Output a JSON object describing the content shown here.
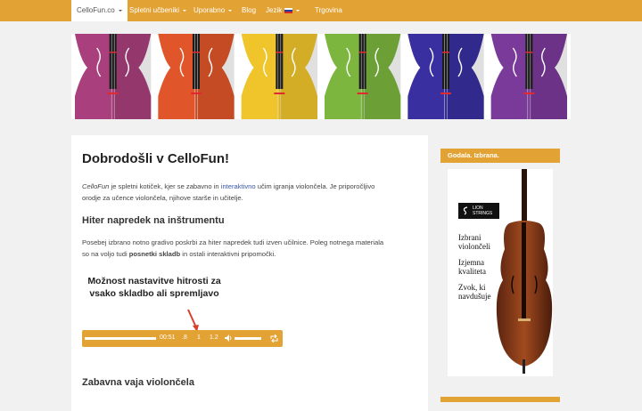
{
  "nav": {
    "brand": "CelloFun.co",
    "items": [
      {
        "label": "Spletni učbeniki"
      },
      {
        "label": "Uporabno"
      },
      {
        "label": "Blog"
      },
      {
        "label": "Jezik"
      },
      {
        "label": "Trgovina"
      }
    ]
  },
  "banner": {
    "cello_colors": [
      "#a93f7c",
      "#e0562a",
      "#f0c52b",
      "#7cb63e",
      "#3a2fa0",
      "#7a3a9a"
    ]
  },
  "main": {
    "title": "Dobrodošli v CelloFun!",
    "intro_em": "CelloFun",
    "intro_a": " je spletni kotiček, kjer se zabavno in ",
    "intro_link": "interaktivno",
    "intro_b": " učim igranja violončela. Je priporočljivo",
    "intro_c": "orodje za učence violončela, njihove starše in učitelje.",
    "h2a": "Hiter napredek na inštrumentu",
    "p2_a": "Posebej izbrano notno gradivo poskrbi za hiter napredek tudi izven učilnice. Poleg notnega materiala",
    "p2_b": "so na voljo tudi ",
    "p2_bold": "posnetki skladb",
    "p2_c": " in ostali interaktivni pripomočki.",
    "promo_text": "Možnost nastavitve hitrosti za vsako skladbo ali spremljavo",
    "player": {
      "time": "00:51",
      "speed_slow": ".8",
      "speed_normal": "1",
      "speed_fast": "1.2"
    },
    "h2b": "Zabavna vaja violončela"
  },
  "sidebar": {
    "heading": "Godala. Izbrana.",
    "ad": {
      "brand_line1": "LION",
      "brand_line2": "STRINGS",
      "line1": "Izbrani",
      "line2": "violončeli",
      "line3": "Izjemna",
      "line4": "kvaliteta",
      "line5": "Zvok, ki",
      "line6": "navdušuje"
    }
  }
}
